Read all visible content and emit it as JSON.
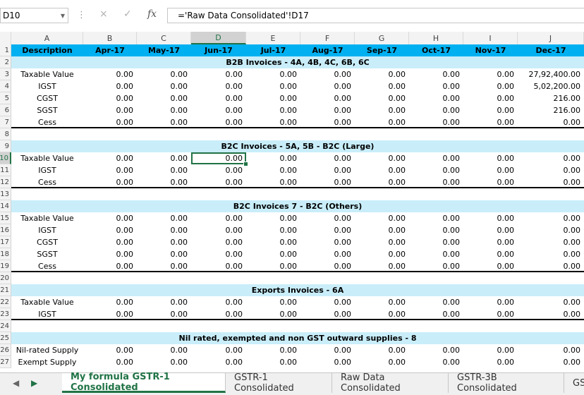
{
  "name_box": "D10",
  "formula": "='Raw Data Consolidated'!D17",
  "formula_icons": {
    "cancel": "×",
    "enter": "✓",
    "fx": "fx"
  },
  "columns": [
    "A",
    "B",
    "C",
    "D",
    "E",
    "F",
    "G",
    "H",
    "I",
    "J"
  ],
  "active_column": "D",
  "active_row": "10",
  "header": [
    "Description",
    "Apr-17",
    "May-17",
    "Jun-17",
    "Jul-17",
    "Aug-17",
    "Sep-17",
    "Oct-17",
    "Nov-17",
    "Dec-17"
  ],
  "rows": [
    {
      "n": "1",
      "type": "header"
    },
    {
      "n": "2",
      "type": "section",
      "title": "B2B Invoices - 4A, 4B, 4C, 6B, 6C"
    },
    {
      "n": "3",
      "type": "data",
      "label": "Taxable Value",
      "values": [
        "0.00",
        "0.00",
        "0.00",
        "0.00",
        "0.00",
        "0.00",
        "0.00",
        "0.00",
        "27,92,400.00"
      ]
    },
    {
      "n": "4",
      "type": "data",
      "label": "IGST",
      "values": [
        "0.00",
        "0.00",
        "0.00",
        "0.00",
        "0.00",
        "0.00",
        "0.00",
        "0.00",
        "5,02,200.00"
      ]
    },
    {
      "n": "5",
      "type": "data",
      "label": "CGST",
      "values": [
        "0.00",
        "0.00",
        "0.00",
        "0.00",
        "0.00",
        "0.00",
        "0.00",
        "0.00",
        "216.00"
      ]
    },
    {
      "n": "6",
      "type": "data",
      "label": "SGST",
      "values": [
        "0.00",
        "0.00",
        "0.00",
        "0.00",
        "0.00",
        "0.00",
        "0.00",
        "0.00",
        "216.00"
      ]
    },
    {
      "n": "7",
      "type": "data",
      "label": "Cess",
      "values": [
        "0.00",
        "0.00",
        "0.00",
        "0.00",
        "0.00",
        "0.00",
        "0.00",
        "0.00",
        "0.00"
      ],
      "thick": true
    },
    {
      "n": "8",
      "type": "empty"
    },
    {
      "n": "9",
      "type": "section",
      "title": "B2C Invoices - 5A, 5B - B2C (Large)"
    },
    {
      "n": "10",
      "type": "data",
      "label": "Taxable Value",
      "values": [
        "0.00",
        "0.00",
        "0.00",
        "0.00",
        "0.00",
        "0.00",
        "0.00",
        "0.00",
        "0.00"
      ]
    },
    {
      "n": "11",
      "type": "data",
      "label": "IGST",
      "values": [
        "0.00",
        "0.00",
        "0.00",
        "0.00",
        "0.00",
        "0.00",
        "0.00",
        "0.00",
        "0.00"
      ]
    },
    {
      "n": "12",
      "type": "data",
      "label": "Cess",
      "values": [
        "0.00",
        "0.00",
        "0.00",
        "0.00",
        "0.00",
        "0.00",
        "0.00",
        "0.00",
        "0.00"
      ],
      "thick": true
    },
    {
      "n": "13",
      "type": "empty"
    },
    {
      "n": "14",
      "type": "section",
      "title": "B2C Invoices 7 - B2C (Others)"
    },
    {
      "n": "15",
      "type": "data",
      "label": "Taxable Value",
      "values": [
        "0.00",
        "0.00",
        "0.00",
        "0.00",
        "0.00",
        "0.00",
        "0.00",
        "0.00",
        "0.00"
      ]
    },
    {
      "n": "16",
      "type": "data",
      "label": "IGST",
      "values": [
        "0.00",
        "0.00",
        "0.00",
        "0.00",
        "0.00",
        "0.00",
        "0.00",
        "0.00",
        "0.00"
      ]
    },
    {
      "n": "17",
      "type": "data",
      "label": "CGST",
      "values": [
        "0.00",
        "0.00",
        "0.00",
        "0.00",
        "0.00",
        "0.00",
        "0.00",
        "0.00",
        "0.00"
      ]
    },
    {
      "n": "18",
      "type": "data",
      "label": "SGST",
      "values": [
        "0.00",
        "0.00",
        "0.00",
        "0.00",
        "0.00",
        "0.00",
        "0.00",
        "0.00",
        "0.00"
      ]
    },
    {
      "n": "19",
      "type": "data",
      "label": "Cess",
      "values": [
        "0.00",
        "0.00",
        "0.00",
        "0.00",
        "0.00",
        "0.00",
        "0.00",
        "0.00",
        "0.00"
      ],
      "thick": true
    },
    {
      "n": "20",
      "type": "empty"
    },
    {
      "n": "21",
      "type": "section",
      "title": "Exports Invoices - 6A"
    },
    {
      "n": "22",
      "type": "data",
      "label": "Taxable Value",
      "values": [
        "0.00",
        "0.00",
        "0.00",
        "0.00",
        "0.00",
        "0.00",
        "0.00",
        "0.00",
        "0.00"
      ]
    },
    {
      "n": "23",
      "type": "data",
      "label": "IGST",
      "values": [
        "0.00",
        "0.00",
        "0.00",
        "0.00",
        "0.00",
        "0.00",
        "0.00",
        "0.00",
        "0.00"
      ],
      "thick": true
    },
    {
      "n": "24",
      "type": "empty"
    },
    {
      "n": "25",
      "type": "section",
      "title": "Nil rated, exempted and non GST outward supplies - 8"
    },
    {
      "n": "26",
      "type": "data",
      "label": "Nil-rated Supply",
      "values": [
        "0.00",
        "0.00",
        "0.00",
        "0.00",
        "0.00",
        "0.00",
        "0.00",
        "0.00",
        "0.00"
      ]
    },
    {
      "n": "27",
      "type": "data",
      "label": "Exempt Supply",
      "values": [
        "0.00",
        "0.00",
        "0.00",
        "0.00",
        "0.00",
        "0.00",
        "0.00",
        "0.00",
        "0.00"
      ]
    }
  ],
  "sheet_tabs": [
    {
      "label": "My formula GSTR-1 Consolidated",
      "active": true
    },
    {
      "label": "GSTR-1 Consolidated",
      "active": false
    },
    {
      "label": "Raw Data Consolidated",
      "active": false
    },
    {
      "label": "GSTR-3B Consolidated",
      "active": false
    },
    {
      "label": "GS",
      "active": false
    }
  ],
  "nav": {
    "prev": "◀",
    "next": "▶"
  },
  "colors": {
    "header_fill": "#00b0f0",
    "section_fill": "#c9eefa",
    "accent": "#217346"
  }
}
